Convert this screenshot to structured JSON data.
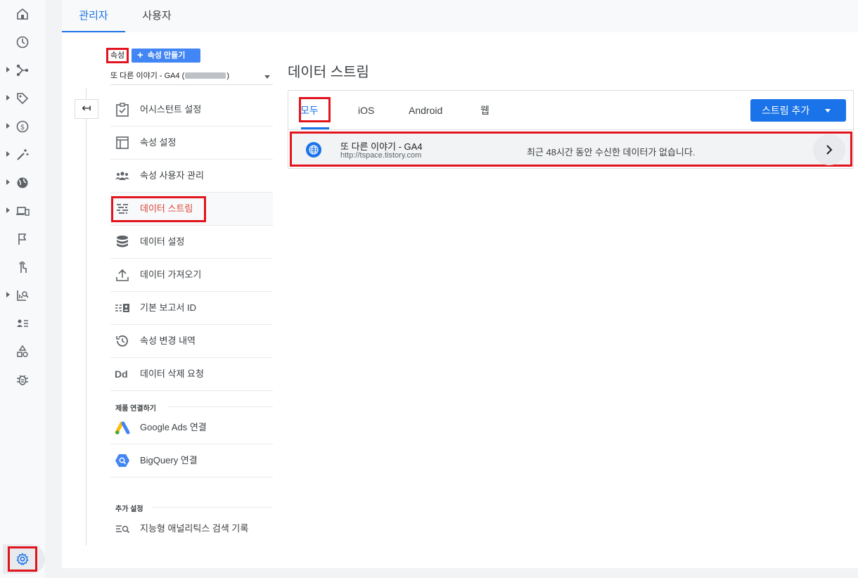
{
  "rail": {
    "items": [
      {
        "icon": "home-icon"
      },
      {
        "icon": "clock-icon"
      },
      {
        "icon": "share-icon",
        "expandable": true
      },
      {
        "icon": "tag-icon",
        "expandable": true
      },
      {
        "icon": "dollar-icon",
        "expandable": true
      },
      {
        "icon": "magic-wand-icon",
        "expandable": true
      },
      {
        "icon": "globe-icon",
        "expandable": true
      },
      {
        "icon": "devices-icon",
        "expandable": true
      },
      {
        "icon": "flag-icon"
      },
      {
        "icon": "touch-icon"
      },
      {
        "icon": "report-search-icon",
        "expandable": true
      },
      {
        "icon": "audience-list-icon"
      },
      {
        "icon": "shapes-icon"
      },
      {
        "icon": "bug-icon"
      }
    ],
    "settings_icon": "gear-icon"
  },
  "top_tabs": {
    "admin": "관리자",
    "user": "사용자"
  },
  "property": {
    "label": "속성",
    "create_button": "속성 만들기",
    "selector_prefix": "또 다른 이야기 - GA4 (",
    "selector_suffix": ")"
  },
  "nav": {
    "items": [
      {
        "label": "어시스턴트 설정",
        "icon": "checklist-icon"
      },
      {
        "label": "속성 설정",
        "icon": "layout-icon"
      },
      {
        "label": "속성 사용자 관리",
        "icon": "people-icon"
      },
      {
        "label": "데이터 스트림",
        "icon": "streams-icon",
        "active": true
      },
      {
        "label": "데이터 설정",
        "icon": "database-icon"
      },
      {
        "label": "데이터 가져오기",
        "icon": "upload-icon"
      },
      {
        "label": "기본 보고서 ID",
        "icon": "reporting-id-icon"
      },
      {
        "label": "속성 변경 내역",
        "icon": "history-icon"
      },
      {
        "label": "데이터 삭제 요청",
        "icon": "dd-icon"
      }
    ],
    "product_links_heading": "제품 연결하기",
    "product_links": [
      {
        "label": "Google Ads 연결",
        "icon": "google-ads-icon"
      },
      {
        "label": "BigQuery 연결",
        "icon": "bigquery-icon"
      }
    ],
    "additional_heading": "추가 설정",
    "additional": [
      {
        "label": "지능형 애널리틱스 검색 기록",
        "icon": "search-history-icon"
      }
    ]
  },
  "content": {
    "title": "데이터 스트림",
    "tabs": [
      "모두",
      "iOS",
      "Android",
      "웹"
    ],
    "add_stream_button": "스트림 추가",
    "stream": {
      "name": "또 다른 이야기 - GA4",
      "url": "http://tspace.tistory.com",
      "status": "최근 48시간 동안 수신한 데이터가 없습니다.",
      "icon": "globe-icon"
    }
  },
  "colors": {
    "accent": "#1a73e8",
    "highlight_box": "#e2141d",
    "active_nav": "#db4437"
  }
}
